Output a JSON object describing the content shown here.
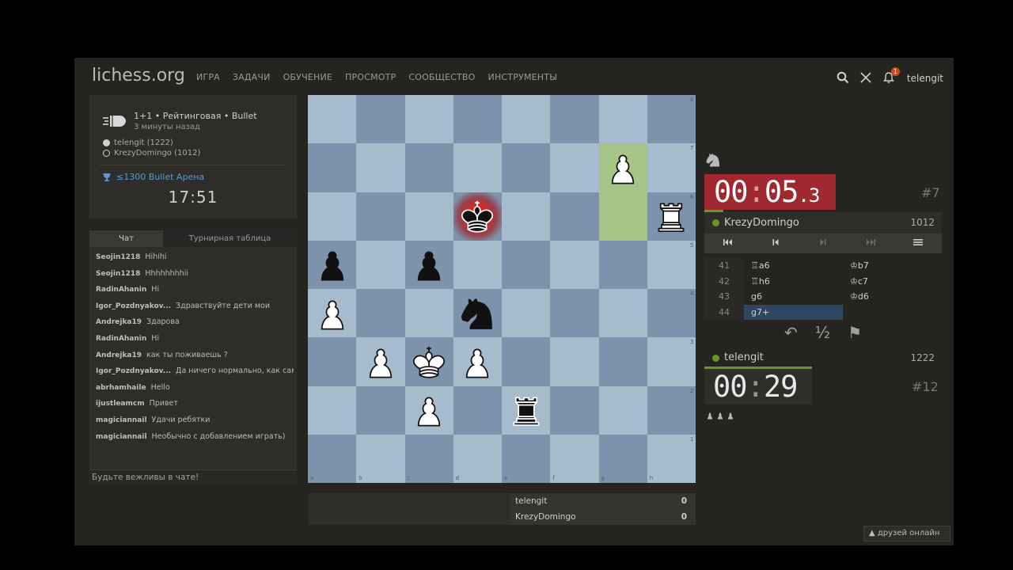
{
  "header": {
    "logo": "lichess.org",
    "nav": [
      "ИГРА",
      "ЗАДАЧИ",
      "ОБУЧЕНИЕ",
      "ПРОСМОТР",
      "СООБЩЕСТВО",
      "ИНСТРУМЕНТЫ"
    ],
    "username": "telengit",
    "notification_count": "1"
  },
  "game": {
    "type": "1+1 • Рейтинговая • Bullet",
    "time_ago": "3 минуты назад",
    "white_player": "telengit (1222)",
    "black_player": "KrezyDomingo (1012)",
    "tournament": "≤1300 Bullet Арена",
    "tournament_clock": "17:51"
  },
  "chat": {
    "tab_chat": "Чат",
    "tab_standings": "Турнирная таблица",
    "messages": [
      {
        "user": "Seojin1218",
        "text": "Hihihi"
      },
      {
        "user": "Seojin1218",
        "text": "Hhhhhhhhii"
      },
      {
        "user": "RadinAhanin",
        "text": "Hi"
      },
      {
        "user": "Igor_Pozdnyakov...",
        "text": "Здравствуйте дети мои"
      },
      {
        "user": "Andrejka19",
        "text": "Здарова"
      },
      {
        "user": "RadinAhanin",
        "text": "Hi"
      },
      {
        "user": "Andrejka19",
        "text": "как ты поживаешь ?"
      },
      {
        "user": "Igor_Pozdnyakov...",
        "text": "Да ничего нормально, как сам?"
      },
      {
        "user": "abrhamhaile",
        "text": "Hello"
      },
      {
        "user": "ijustleamcm",
        "text": "Привет"
      },
      {
        "user": "magiciannail",
        "text": "Удачи ребятки"
      },
      {
        "user": "magiciannail",
        "text": "Необычно с добавлением играть)"
      }
    ],
    "input_placeholder": "Будьте вежливы в чате!"
  },
  "board": {
    "files": [
      "a",
      "b",
      "c",
      "d",
      "e",
      "f",
      "g",
      "h"
    ],
    "ranks": [
      "8",
      "7",
      "6",
      "5",
      "4",
      "3",
      "2",
      "1"
    ],
    "pieces": [
      {
        "square": "g7",
        "piece": "wP"
      },
      {
        "square": "d6",
        "piece": "bK"
      },
      {
        "square": "h6",
        "piece": "wR"
      },
      {
        "square": "a5",
        "piece": "bP"
      },
      {
        "square": "c5",
        "piece": "bP"
      },
      {
        "square": "a4",
        "piece": "wP"
      },
      {
        "square": "d4",
        "piece": "bN"
      },
      {
        "square": "b3",
        "piece": "wP"
      },
      {
        "square": "c3",
        "piece": "wK"
      },
      {
        "square": "d3",
        "piece": "wP"
      },
      {
        "square": "c2",
        "piece": "wP"
      },
      {
        "square": "e2",
        "piece": "bR"
      }
    ],
    "last_move": [
      "g6",
      "g7"
    ],
    "check_square": "d6"
  },
  "crosstable": [
    {
      "name": "telengit",
      "score": "0"
    },
    {
      "name": "KrezyDomingo",
      "score": "0"
    }
  ],
  "opponent": {
    "name": "KrezyDomingo",
    "rating": "1012",
    "clock_main": "00",
    "clock_sec": "05",
    "clock_tenth": ".3",
    "rank": "#7"
  },
  "player": {
    "name": "telengit",
    "rating": "1222",
    "clock_main": "00",
    "clock_sec": "29",
    "rank": "#12"
  },
  "moves": [
    {
      "n": "41",
      "w": "♖a6",
      "b": "♔b7"
    },
    {
      "n": "42",
      "w": "♖h6",
      "b": "♔c7"
    },
    {
      "n": "43",
      "w": "g6",
      "b": "♔d6"
    },
    {
      "n": "44",
      "w": "g7+",
      "b": ""
    }
  ],
  "actions": {
    "takeback": "↶",
    "draw": "½",
    "resign": "⚑"
  },
  "footer": {
    "friends": "▲ друзей онлайн"
  }
}
